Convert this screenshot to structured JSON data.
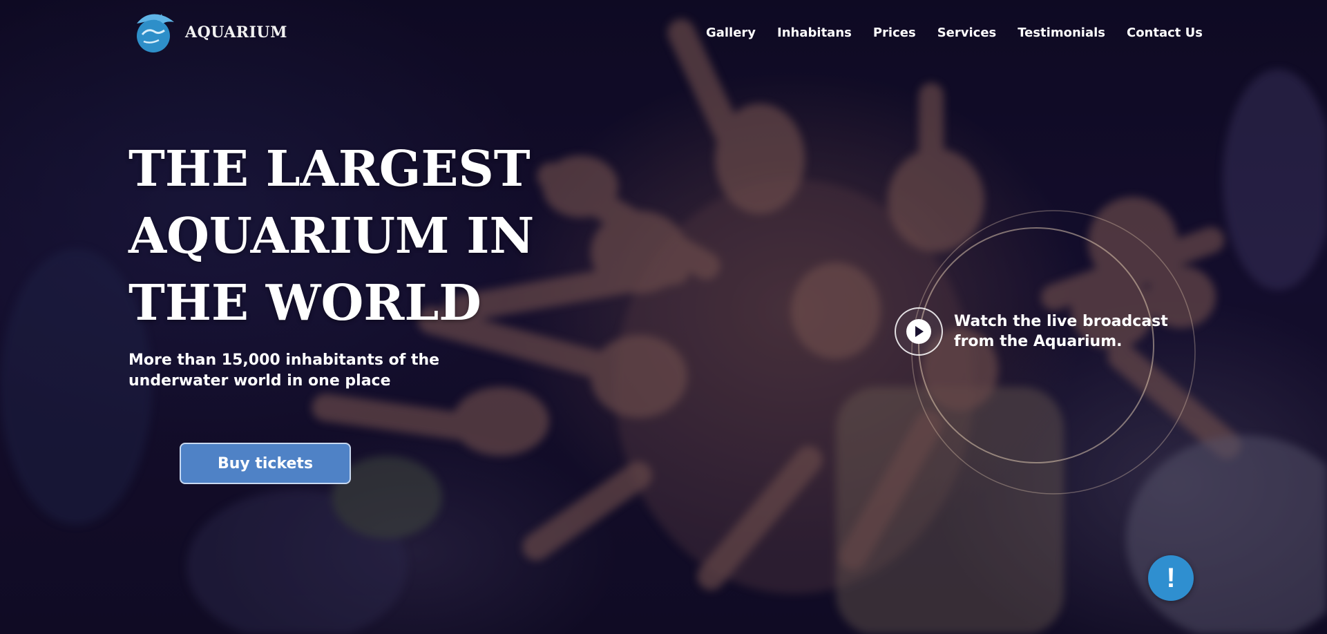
{
  "brand": {
    "name": "AQUARIUM",
    "logo_icon": "dolphin-globe-icon"
  },
  "nav": {
    "items": [
      {
        "label": "Gallery"
      },
      {
        "label": "Inhabitans"
      },
      {
        "label": "Prices"
      },
      {
        "label": "Services"
      },
      {
        "label": "Testimonials"
      },
      {
        "label": "Contact Us"
      }
    ]
  },
  "hero": {
    "title": "THE LARGEST AQUARIUM IN THE WORLD",
    "subtitle": "More than 15,000 inhabitants of the underwater world in one place",
    "cta_label": "Buy tickets"
  },
  "broadcast": {
    "text": "Watch the live broadcast from the Aquarium.",
    "icon": "play-icon"
  },
  "help": {
    "symbol": "!",
    "icon": "exclamation-icon"
  },
  "colors": {
    "cta": "#4f82c6",
    "help_bubble": "#2f8fd0",
    "text": "#ffffff"
  }
}
